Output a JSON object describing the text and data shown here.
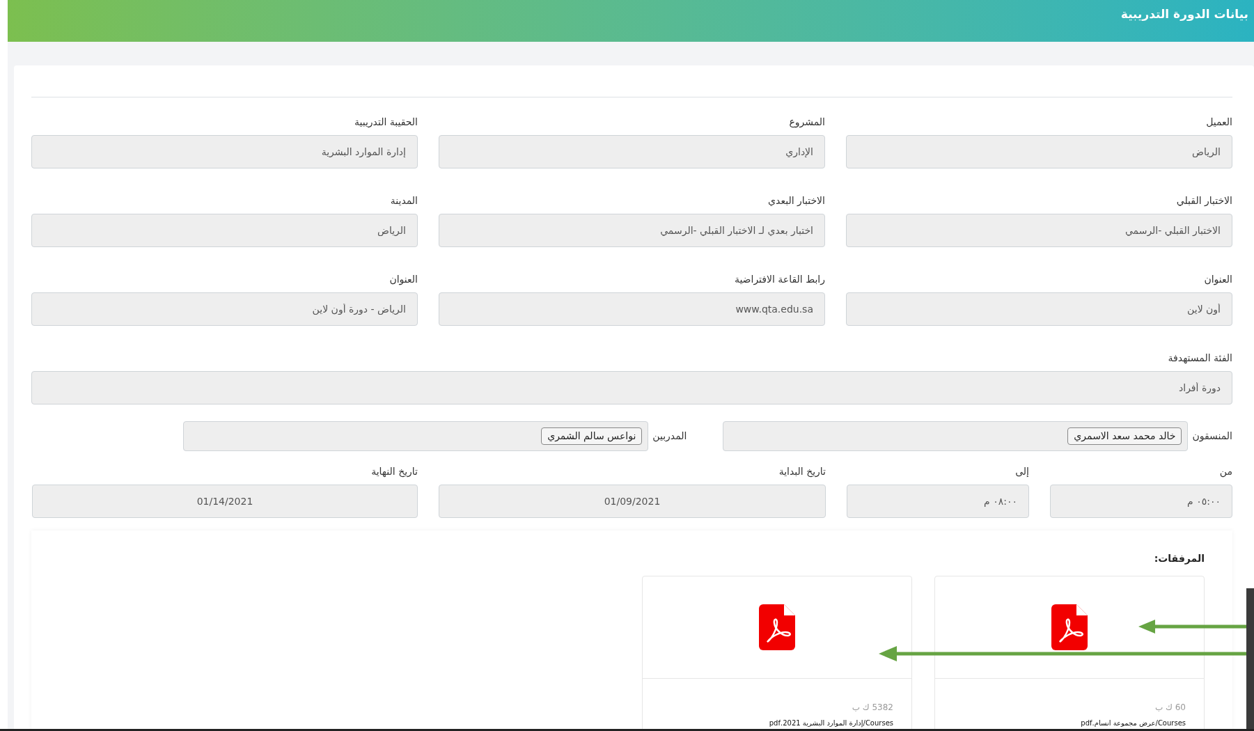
{
  "header": {
    "title": "بيانات الدورة التدريبية"
  },
  "field_rows": [
    [
      {
        "label": "العميل",
        "value": "الرياض"
      },
      {
        "label": "المشروع",
        "value": "الإداري"
      },
      {
        "label": "الحقيبة التدريبية",
        "value": "إدارة الموارد البشرية"
      }
    ],
    [
      {
        "label": "الاختبار القبلي",
        "value": "الاختبار القبلي -الرسمي"
      },
      {
        "label": "الاختبار البعدي",
        "value": "اختبار بعدي لـ الاختبار القبلي -الرسمي"
      },
      {
        "label": "المدينة",
        "value": "الرياض"
      }
    ],
    [
      {
        "label": "العنوان",
        "value": "أون لاين"
      },
      {
        "label": "رابط القاعة الافتراضية",
        "value": "www.qta.edu.sa"
      },
      {
        "label": "العنوان",
        "value": "الرياض - دورة أون لاين"
      }
    ],
    [
      {
        "label": "الفئة المستهدفة",
        "value": "دورة أفراد"
      }
    ]
  ],
  "people": [
    {
      "label": "المنسقون",
      "chips": [
        "خالد محمد سعد الاسمري"
      ]
    },
    {
      "label": "المدربين",
      "chips": [
        "نواعس سالم الشمري"
      ]
    }
  ],
  "schedule": [
    {
      "label": "من",
      "value": "٠٥:٠٠ م",
      "kind": "time"
    },
    {
      "label": "إلى",
      "value": "٠٨:٠٠ م",
      "kind": "time"
    },
    {
      "label": "تاريخ البداية",
      "value": "01/09/2021",
      "kind": "date"
    },
    {
      "label": "تاريخ النهاية",
      "value": "01/14/2021",
      "kind": "date"
    }
  ],
  "attachments": {
    "title": "المرفقات:",
    "files": [
      {
        "size": "60 ك ب",
        "path": "Courses/عرض مجموعة انسام.pdf"
      },
      {
        "size": "5382 ك ب",
        "path": "Courses/إدارة الموارد البشرية 2021.pdf"
      }
    ]
  }
}
